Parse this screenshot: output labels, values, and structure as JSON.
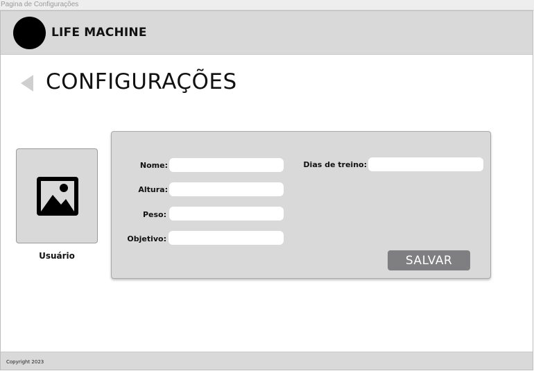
{
  "window": {
    "title": "Pagina de Configurações"
  },
  "header": {
    "brand": "LIFE MACHINE",
    "logo_icon": "circle-logo"
  },
  "page": {
    "title": "CONFIGURAÇÕES",
    "back_icon": "triangle-left-icon"
  },
  "user": {
    "label": "Usuário",
    "avatar_icon": "image-placeholder-icon"
  },
  "form": {
    "fields": [
      {
        "label": "Nome:",
        "value": "",
        "placeholder": ""
      },
      {
        "label": "Altura:",
        "value": "",
        "placeholder": ""
      },
      {
        "label": "Peso:",
        "value": "",
        "placeholder": ""
      },
      {
        "label": "Objetivo:",
        "value": "",
        "placeholder": ""
      },
      {
        "label": "Dias de treino:",
        "value": "",
        "placeholder": ""
      }
    ],
    "save_label": "SALVAR"
  },
  "footer": {
    "copyright": "Copyright 2023"
  },
  "colors": {
    "panel": "#d9d9d9",
    "button": "#7f7f82",
    "logo": "#000000",
    "back_arrow": "#cfcfcf"
  }
}
